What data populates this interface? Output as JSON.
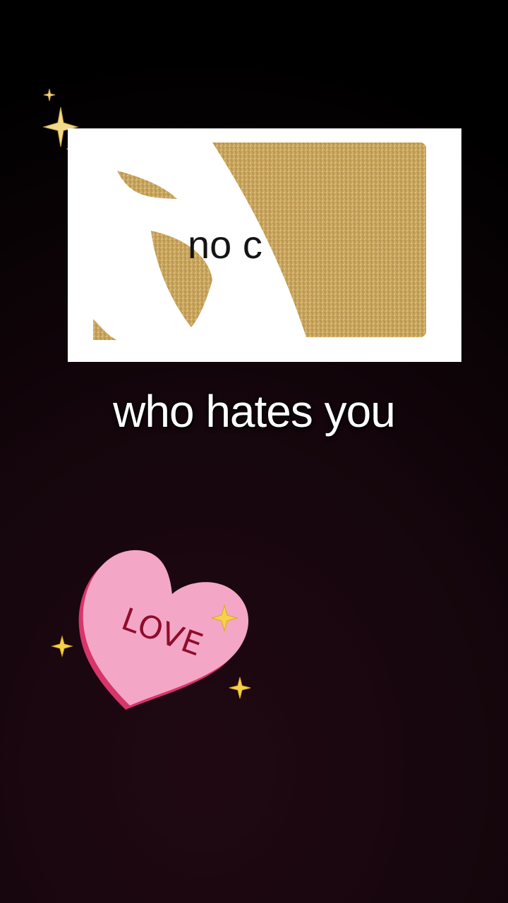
{
  "card": {
    "visible_text": "no c"
  },
  "caption": {
    "text": "who hates you"
  },
  "sticker": {
    "label": "LOVE",
    "heart_color": "#f4a6c6",
    "heart_edge_color": "#d8356a",
    "label_color": "#8e0d2b",
    "star_color": "#f6d24a"
  },
  "theme": {
    "background": "#16060d",
    "caption_color": "#ffffff",
    "card_gold": "#c9a55a"
  },
  "icons": [
    "sparkle-icon",
    "heart-sticker-icon",
    "star-icon"
  ]
}
